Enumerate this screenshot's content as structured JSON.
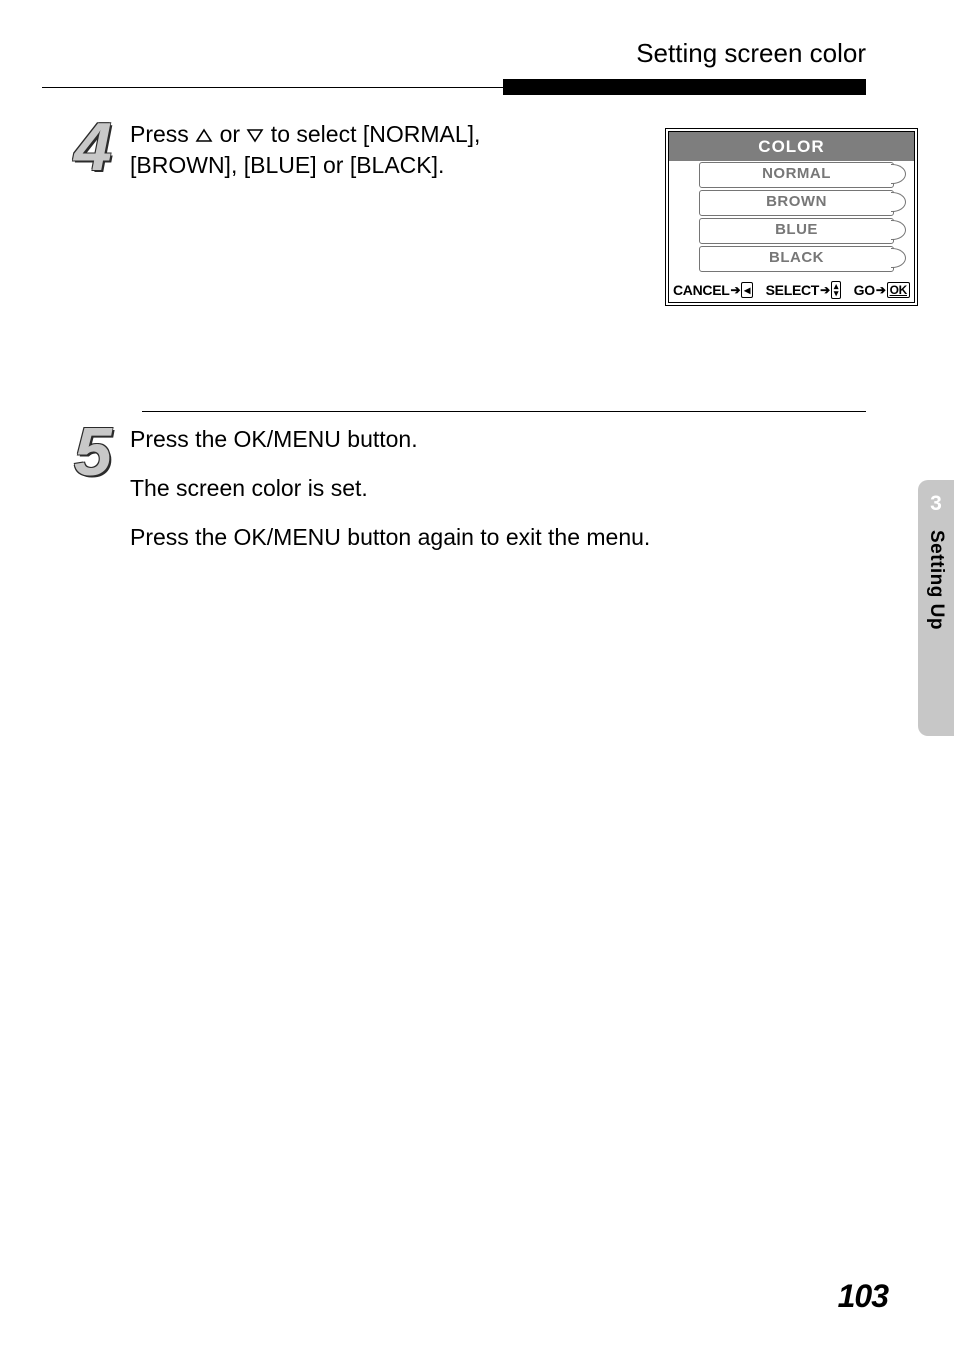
{
  "header": {
    "title": "Setting screen color"
  },
  "side_tab": {
    "chapter": "3",
    "label": "Setting Up"
  },
  "page_number": "103",
  "step4": {
    "number": "4",
    "press": "Press ",
    "or": " or ",
    "select_text": " to select [NORMAL], [BROWN], [BLUE] or [BLACK]."
  },
  "screen": {
    "title": "COLOR",
    "items": [
      "NORMAL",
      "BROWN",
      "BLUE",
      "BLACK"
    ],
    "hints": {
      "cancel": "CANCEL",
      "select": "SELECT",
      "go": "GO",
      "ok": "OK"
    }
  },
  "step5": {
    "number": "5",
    "line1": "Press the OK/MENU button.",
    "line2": "The screen color is set.",
    "line3": "Press the OK/MENU button again to exit the menu."
  }
}
